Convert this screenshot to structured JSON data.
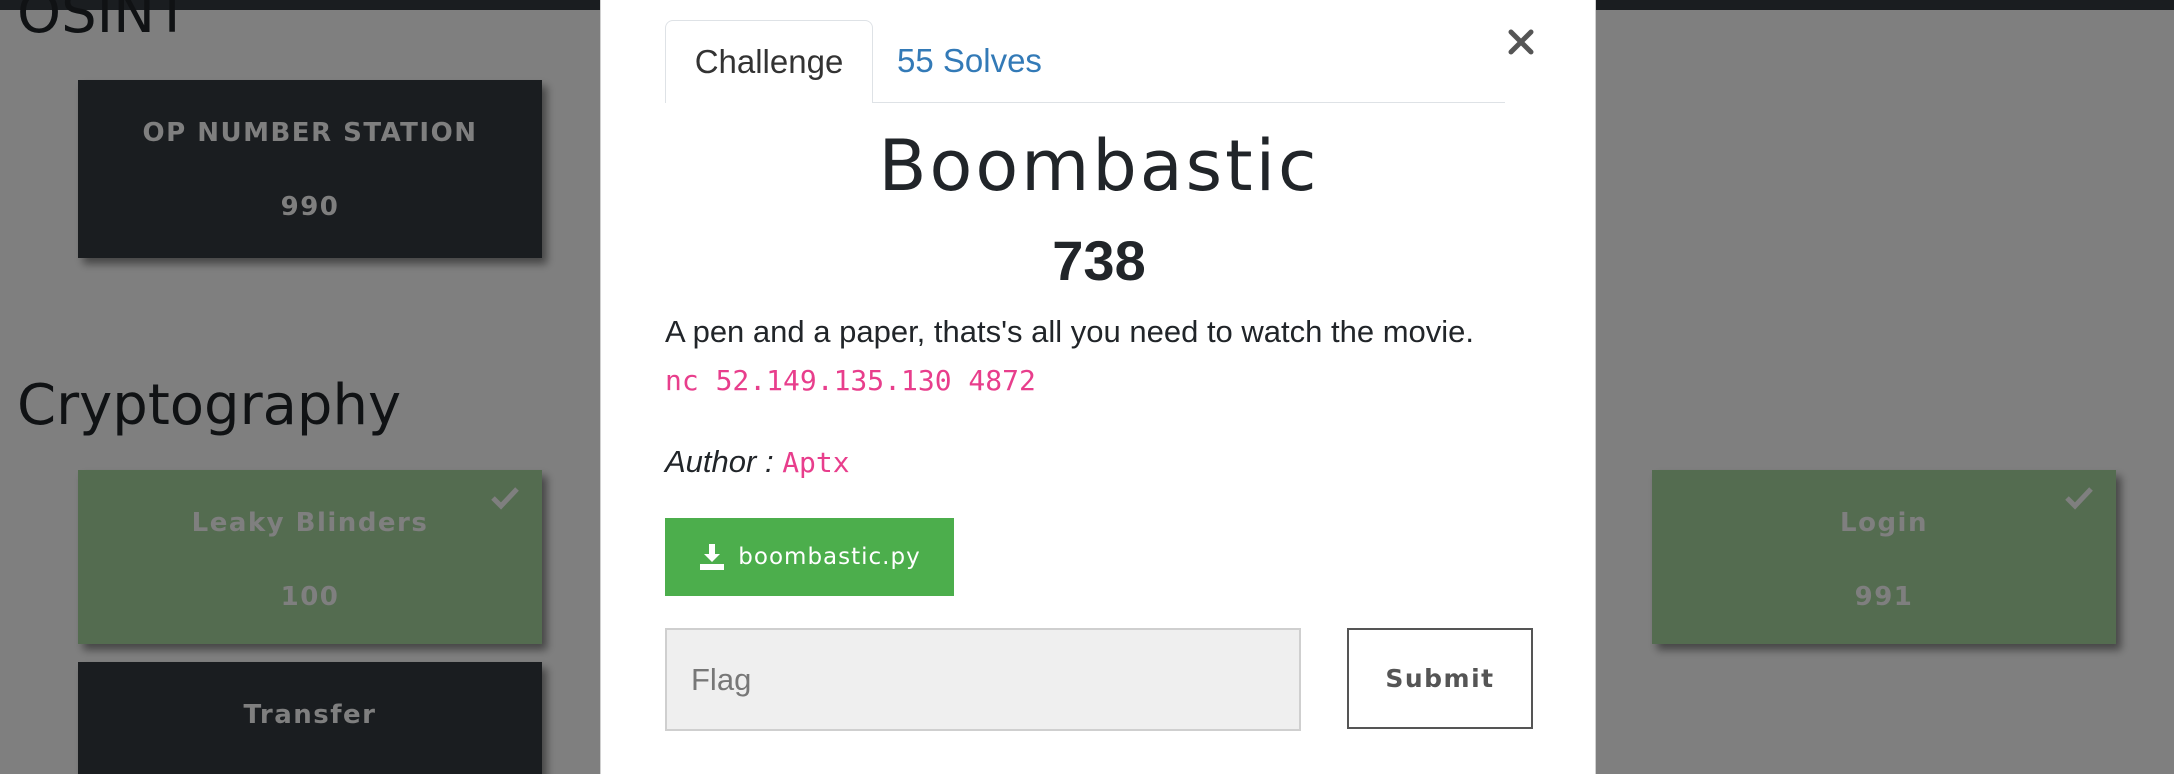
{
  "background": {
    "sections": [
      {
        "title": "OSINT"
      },
      {
        "title": "Cryptography"
      }
    ],
    "tiles": [
      {
        "name": "OP NUMBER STATION",
        "value": "990",
        "state": "dark"
      },
      {
        "name": "Leaky Blinders",
        "value": "100",
        "state": "solved"
      },
      {
        "name": "Transfer",
        "value": "",
        "state": "dark"
      },
      {
        "name": "Login",
        "value": "991",
        "state": "solved"
      }
    ]
  },
  "modal": {
    "tabs": [
      {
        "label": "Challenge",
        "active": true
      },
      {
        "label": "55 Solves",
        "active": false
      }
    ],
    "close_label": "×",
    "challenge": {
      "name": "Boombastic",
      "value": "738",
      "description": "A pen and a paper, thats's all you need to watch the movie.",
      "connection": "nc 52.149.135.130 4872",
      "author_label": "Author",
      "author_separator": " : ",
      "author": "Aptx"
    },
    "download": {
      "label": "boombastic.py",
      "icon": "download-icon"
    },
    "flag": {
      "placeholder": "Flag",
      "value": ""
    },
    "submit_label": "Submit"
  },
  "colors": {
    "overlay": "rgba(0,0,0,0.5)",
    "tile_dark": "#343a40",
    "tile_solved": "#a8d8a0",
    "download_button": "#4cae4c",
    "code_pink": "#e83e8c",
    "tab_link": "#337ab7"
  }
}
